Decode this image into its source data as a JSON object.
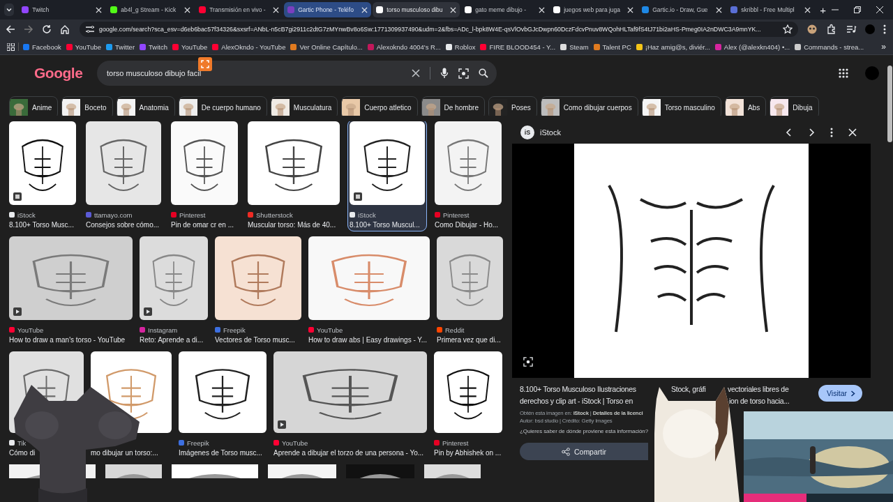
{
  "tabs": [
    {
      "title": "Twitch",
      "kind": "twitch",
      "selected": false,
      "hovered": false
    },
    {
      "title": "ab4l_g Stream - Kick",
      "kind": "kick",
      "selected": false,
      "hovered": false
    },
    {
      "title": "Transmisión en vivo -",
      "kind": "youtube",
      "selected": false,
      "hovered": false
    },
    {
      "title": "Gartic Phone - Teléfo",
      "kind": "phone",
      "selected": false,
      "hovered": true
    },
    {
      "title": "torso musculoso dibu",
      "kind": "google",
      "selected": true,
      "hovered": false
    },
    {
      "title": "gato meme dibujo -",
      "kind": "google",
      "selected": false,
      "hovered": false
    },
    {
      "title": "juegos web para juga",
      "kind": "google",
      "selected": false,
      "hovered": false
    },
    {
      "title": "Gartic.io - Draw, Gue",
      "kind": "gartic",
      "selected": false,
      "hovered": false
    },
    {
      "title": "skribbl - Free Multipl",
      "kind": "skribbl",
      "selected": false,
      "hovered": false
    }
  ],
  "new_tab": "+",
  "address": "google.com/search?sca_esv=d6eb6bac57f34326&sxsrf=ANbL-n5cB7gi2911c2dtG7zMYnwBv8o6Sw:1771309937490&udm=2&fbs=ADc_l-bpk8W4E-qsVlOvbGJcDwpn60DczFdcvPnuv8WQohHLTaf9fS4tJ71bi2aHS-Pmeg0IA2nDWC3A9mnYK...",
  "bookmarks": [
    {
      "label": "Facebook",
      "kind": "facebook"
    },
    {
      "label": "YouTube",
      "kind": "youtube"
    },
    {
      "label": "Twitter",
      "kind": "twitter"
    },
    {
      "label": "Twitch",
      "kind": "twitch"
    },
    {
      "label": "YouTube",
      "kind": "youtube"
    },
    {
      "label": "AlexOkndo - YouTube",
      "kind": "youtube"
    },
    {
      "label": "Ver Online Capítulo...",
      "kind": "orange"
    },
    {
      "label": "Alexokndo 4004's R...",
      "kind": "pink"
    },
    {
      "label": "Roblox",
      "kind": "roblox"
    },
    {
      "label": "FIRE BLOOD454 - Y...",
      "kind": "youtube"
    },
    {
      "label": "Steam",
      "kind": "steam"
    },
    {
      "label": "Talent PC",
      "kind": "orange"
    },
    {
      "label": "¡Haz amig@s, diviér...",
      "kind": "yellow"
    },
    {
      "label": "Alex (@alexkn404) •...",
      "kind": "instagram"
    },
    {
      "label": "Commands - strea...",
      "kind": "dark"
    }
  ],
  "bookmarks_more": "»",
  "logo": "Google",
  "search": {
    "value": "torso musculoso dibujo facil"
  },
  "chips": [
    "Anime",
    "Boceto",
    "Anatomia",
    "De cuerpo humano",
    "Musculatura",
    "Cuerpo atletico",
    "De hombre",
    "Poses",
    "Como dibujar cuerpos",
    "Torso masculino",
    "Abs",
    "Dibuja"
  ],
  "rows": [
    {
      "items": [
        {
          "source": "iStock",
          "kind": "istock",
          "title": "8.100+ Torso Musc...",
          "image_badge": true,
          "video_badge": false,
          "selected": false
        },
        {
          "source": "ttamayo.com",
          "kind": "blue",
          "title": "Consejos sobre cómo...",
          "image_badge": false,
          "video_badge": false,
          "selected": false
        },
        {
          "source": "Pinterest",
          "kind": "pinterest",
          "title": "Pin de omar cr en ...",
          "image_badge": false,
          "video_badge": false,
          "selected": false
        },
        {
          "source": "Shutterstock",
          "kind": "shutterstock",
          "title": "Muscular torso: Más de 40...",
          "image_badge": false,
          "video_badge": false,
          "selected": false
        },
        {
          "source": "iStock",
          "kind": "istock",
          "title": "8.100+ Torso Muscul...",
          "image_badge": true,
          "video_badge": false,
          "selected": true
        },
        {
          "source": "Pinterest",
          "kind": "pinterest",
          "title": "Como Dibujar - Ho...",
          "image_badge": false,
          "video_badge": false,
          "selected": false
        }
      ]
    },
    {
      "items": [
        {
          "source": "YouTube",
          "kind": "youtube",
          "title": "How to draw a man's torso - YouTube",
          "image_badge": false,
          "video_badge": true,
          "selected": false
        },
        {
          "source": "Instagram",
          "kind": "instagram",
          "title": "Reto: Aprende a di...",
          "image_badge": false,
          "video_badge": true,
          "selected": false
        },
        {
          "source": "Freepik",
          "kind": "freepik",
          "title": "Vectores de Torso musc...",
          "image_badge": false,
          "video_badge": false,
          "selected": false
        },
        {
          "source": "YouTube",
          "kind": "youtube",
          "title": "How to draw abs | Easy drawings - Y...",
          "image_badge": false,
          "video_badge": false,
          "selected": false
        },
        {
          "source": "Reddit",
          "kind": "reddit",
          "title": "Primera vez que di...",
          "image_badge": false,
          "video_badge": false,
          "selected": false
        }
      ]
    },
    {
      "items": [
        {
          "source": "Tik",
          "kind": "tiktok",
          "title": "Cómo di",
          "image_badge": false,
          "video_badge": false,
          "selected": false
        },
        {
          "title": "mo dibujar un torso:...",
          "image_badge": false,
          "video_badge": false,
          "selected": false
        },
        {
          "source": "Freepik",
          "kind": "freepik",
          "title": "Imágenes de Torso musc...",
          "image_badge": false,
          "video_badge": false,
          "selected": false
        },
        {
          "source": "YouTube",
          "kind": "youtube",
          "title": "Aprende a dibujar el torzo de una persona - Yo...",
          "image_badge": false,
          "video_badge": true,
          "selected": false
        },
        {
          "source": "Pinterest",
          "kind": "pinterest",
          "title": "Pin by Abhishek on ...",
          "image_badge": false,
          "video_badge": false,
          "selected": false
        }
      ]
    }
  ],
  "preview": {
    "logo": "iS",
    "source": "iStock",
    "title_lines": [
      [
        "8.100+ Torso Musculoso Ilustraciones",
        "Stock, gráfi",
        "vectoriales libres de"
      ],
      [
        "derechos y clip art - iStock | Torso en",
        "ion de torso hacia..."
      ]
    ],
    "visit": "Visitar",
    "meta": [
      "Obtén esta imagen en: **iStock** | **Detalles de la licenci**",
      "Autor: bsd studio | Crédito: Getty Images"
    ],
    "question": "¿Quieres saber de dónde proviene esta información?",
    "share": "Compartir"
  }
}
